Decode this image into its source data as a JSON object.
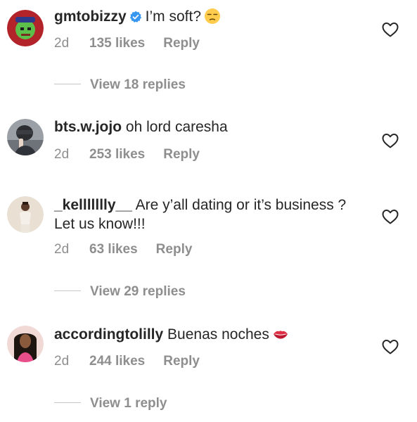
{
  "comments": [
    {
      "username": "gmtobizzy",
      "verified": true,
      "text": "I’m soft?",
      "emoji": "unamused-face",
      "time": "2d",
      "likes": "135 likes",
      "reply": "Reply",
      "view_replies": "View 18 replies"
    },
    {
      "username": "bts.w.jojo",
      "verified": false,
      "text": "oh lord caresha",
      "time": "2d",
      "likes": "253 likes",
      "reply": "Reply"
    },
    {
      "username": "_kellllllly__",
      "verified": false,
      "text": "Are y’all dating or it’s business ? Let us know!!!",
      "time": "2d",
      "likes": "63 likes",
      "reply": "Reply",
      "view_replies": "View 29 replies"
    },
    {
      "username": "accordingtolilly",
      "verified": false,
      "text": "Buenas noches",
      "emoji": "kiss-mark",
      "time": "2d",
      "likes": "244 likes",
      "reply": "Reply",
      "view_replies": "View 1 reply"
    }
  ],
  "colors": {
    "text_primary": "#262626",
    "text_secondary": "#8e8e8e",
    "verified_blue": "#3897f0",
    "divider": "#c7c7c7"
  },
  "icons": {
    "like": "heart-outline-icon",
    "verified": "verified-badge-icon"
  }
}
